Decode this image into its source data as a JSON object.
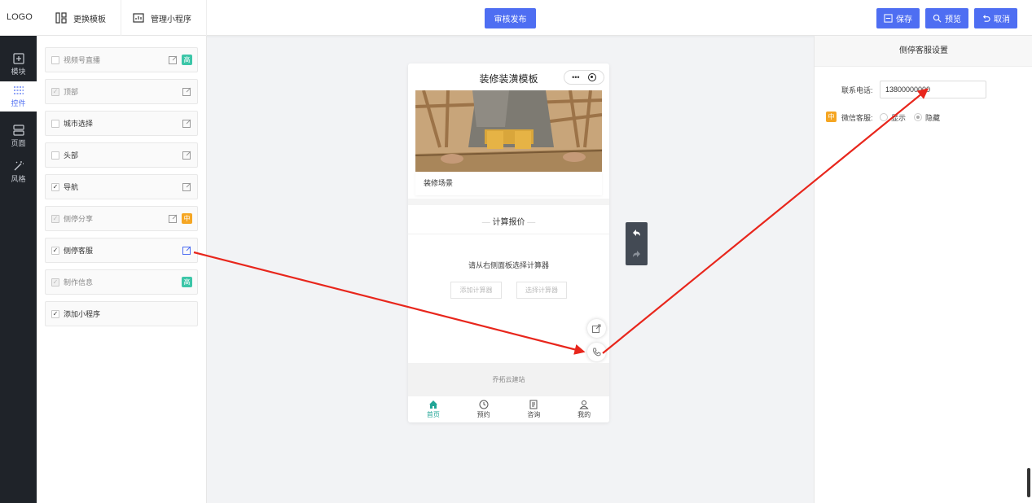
{
  "topbar": {
    "logo": "LOGO",
    "change_template": "更换模板",
    "manage_app": "管理小程序",
    "publish": "审核发布",
    "save": "保存",
    "preview": "预览",
    "cancel": "取消"
  },
  "sidenav": [
    {
      "label": "模块",
      "icon": "plus-square-icon",
      "active": false
    },
    {
      "label": "控件",
      "icon": "sliders-icon",
      "active": true
    },
    {
      "label": "页面",
      "icon": "page-icon",
      "active": false
    },
    {
      "label": "风格",
      "icon": "magic-wand-icon",
      "active": false
    }
  ],
  "controls": [
    {
      "label": "视频号直播",
      "checked": false,
      "disabled": false,
      "tag": "高",
      "tag_color": "#3cc6a8"
    },
    {
      "label": "顶部",
      "checked": true,
      "disabled": true,
      "tag": "",
      "tag_color": ""
    },
    {
      "label": "城市选择",
      "checked": false,
      "disabled": false,
      "tag": "",
      "tag_color": ""
    },
    {
      "label": "头部",
      "checked": false,
      "disabled": false,
      "tag": "",
      "tag_color": ""
    },
    {
      "label": "导航",
      "checked": true,
      "disabled": false,
      "tag": "",
      "tag_color": ""
    },
    {
      "label": "侧停分享",
      "checked": true,
      "disabled": true,
      "tag": "中",
      "tag_color": "#f5a623"
    },
    {
      "label": "侧停客服",
      "checked": true,
      "disabled": false,
      "tag": "",
      "tag_color": ""
    },
    {
      "label": "制作信息",
      "checked": true,
      "disabled": true,
      "tag": "高",
      "tag_color": "#3cc6a8"
    },
    {
      "label": "添加小程序",
      "checked": true,
      "disabled": false,
      "tag": "",
      "tag_color": ""
    }
  ],
  "phone": {
    "title": "装修装潢模板",
    "banner_caption": "装修场景",
    "calc_title": "计算报价",
    "calc_tip": "请从右侧面板选择计算器",
    "add_calc": "添加计算器",
    "select_calc": "选择计算器",
    "footer": "乔拓云建站",
    "tabs": [
      {
        "label": "首页",
        "icon": "home-icon",
        "active": true
      },
      {
        "label": "预约",
        "icon": "clock-icon",
        "active": false
      },
      {
        "label": "咨询",
        "icon": "document-icon",
        "active": false
      },
      {
        "label": "我的",
        "icon": "user-icon",
        "active": false
      }
    ]
  },
  "settings": {
    "title": "侧停客服设置",
    "phone_label": "联系电话:",
    "phone_value": "13800000000",
    "wechat_tag": "中",
    "wechat_label": "微信客服:",
    "option_show": "显示",
    "option_hide": "隐藏",
    "selected": "隐藏"
  },
  "colors": {
    "accent": "#4e6ef2",
    "sidebar": "#1f2329",
    "tab_active": "#20a596",
    "annotation": "#e8261c"
  }
}
